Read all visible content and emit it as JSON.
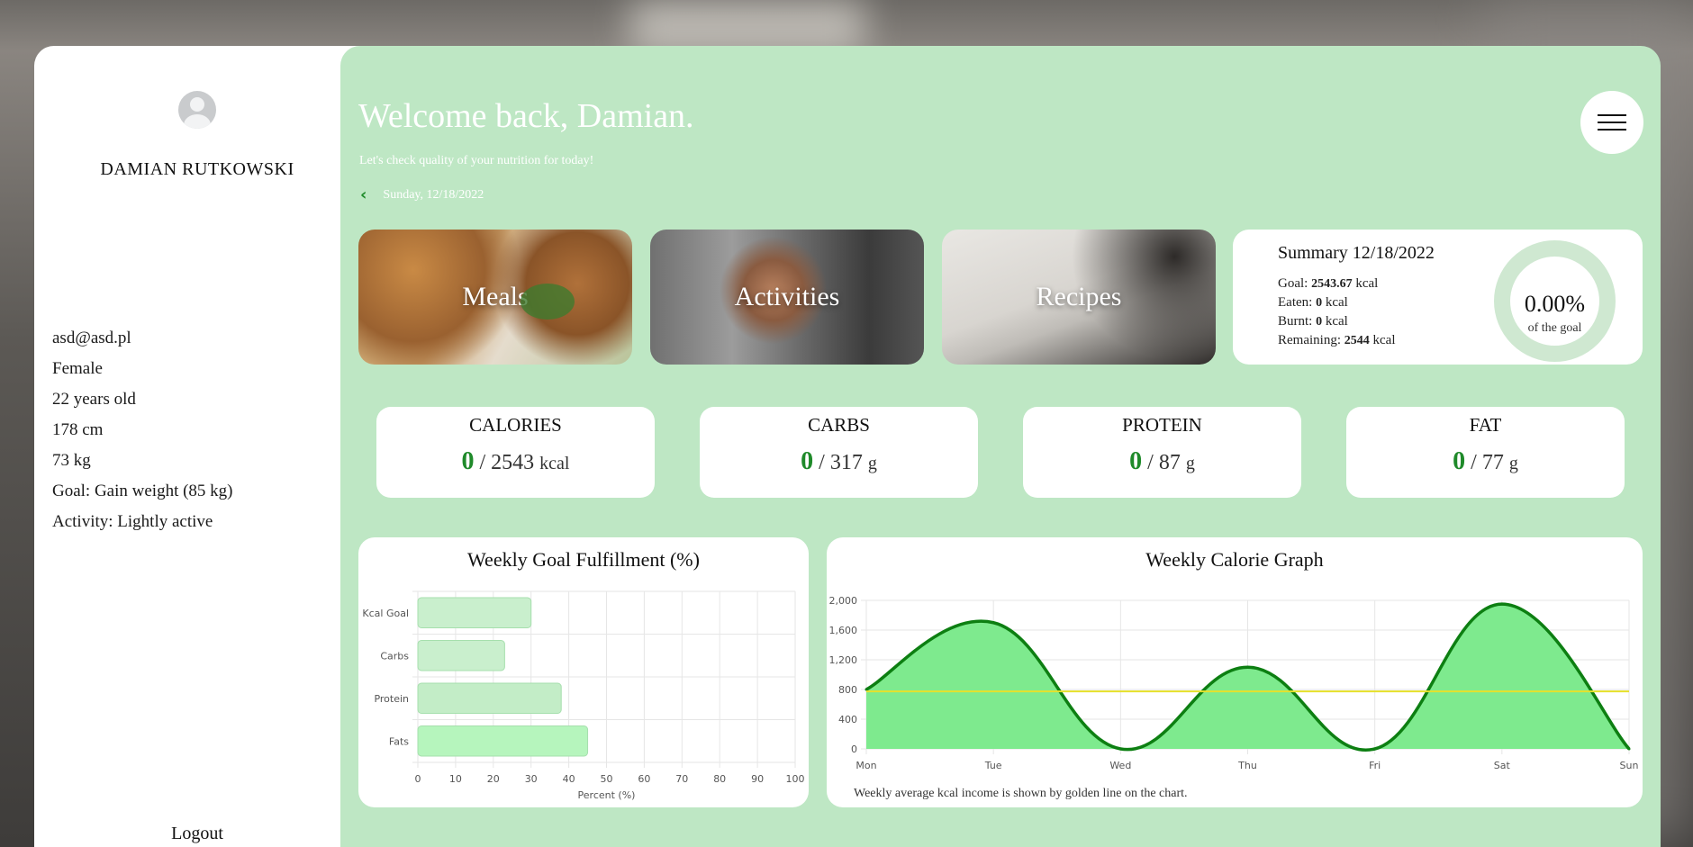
{
  "user": {
    "name": "DAMIAN RUTKOWSKI",
    "details": [
      "asd@asd.pl",
      "Female",
      "22 years old",
      "178 cm",
      "73 kg",
      "Goal: Gain weight (85 kg)",
      "Activity: Lightly active"
    ],
    "logout_label": "Logout"
  },
  "header": {
    "welcome": "Welcome back, Damian.",
    "subtitle": "Let's check quality of your nutrition for today!",
    "date": "Sunday, 12/18/2022"
  },
  "tiles": [
    "Meals",
    "Activities",
    "Recipes"
  ],
  "summary": {
    "title": "Summary 12/18/2022",
    "goal_label": "Goal:",
    "goal_value": "2543.67",
    "eaten_label": "Eaten:",
    "eaten_value": "0",
    "burnt_label": "Burnt:",
    "burnt_value": "0",
    "remaining_label": "Remaining:",
    "remaining_value": "2544",
    "unit": "kcal",
    "percent": "0.00%",
    "percent_caption": "of the goal"
  },
  "macros": [
    {
      "name": "CALORIES",
      "current": "0",
      "target": "2543",
      "unit": "kcal"
    },
    {
      "name": "CARBS",
      "current": "0",
      "target": "317",
      "unit": "g"
    },
    {
      "name": "PROTEIN",
      "current": "0",
      "target": "87",
      "unit": "g"
    },
    {
      "name": "FAT",
      "current": "0",
      "target": "77",
      "unit": "g"
    }
  ],
  "chart_data": [
    {
      "type": "bar",
      "orientation": "horizontal",
      "title": "Weekly Goal Fulfillment (%)",
      "categories": [
        "Kcal Goal",
        "Carbs",
        "Protein",
        "Fats"
      ],
      "values": [
        30,
        23,
        38,
        45
      ],
      "xlabel": "Percent (%)",
      "xlim": [
        0,
        100
      ],
      "xticks": [
        0,
        10,
        20,
        30,
        40,
        50,
        60,
        70,
        80,
        90,
        100
      ],
      "grid": true,
      "colors": [
        "#c9efcd",
        "#c9efcd",
        "#c3edc7",
        "#b6f5bd"
      ]
    },
    {
      "type": "area",
      "title": "Weekly Calorie Graph",
      "categories": [
        "Mon",
        "Tue",
        "Wed",
        "Thu",
        "Fri",
        "Sat",
        "Sun"
      ],
      "values": [
        800,
        1700,
        0,
        1100,
        0,
        1950,
        0
      ],
      "average": 775,
      "ylim": [
        0,
        2000
      ],
      "yticks": [
        "0",
        "400",
        "800",
        "1,200",
        "1,600",
        "2,000"
      ],
      "grid": true,
      "fill_color": "#7eea8e",
      "line_color": "#0d7f12",
      "average_color": "#e6e12b",
      "note": "Weekly average kcal income is shown by golden line on the chart."
    }
  ]
}
